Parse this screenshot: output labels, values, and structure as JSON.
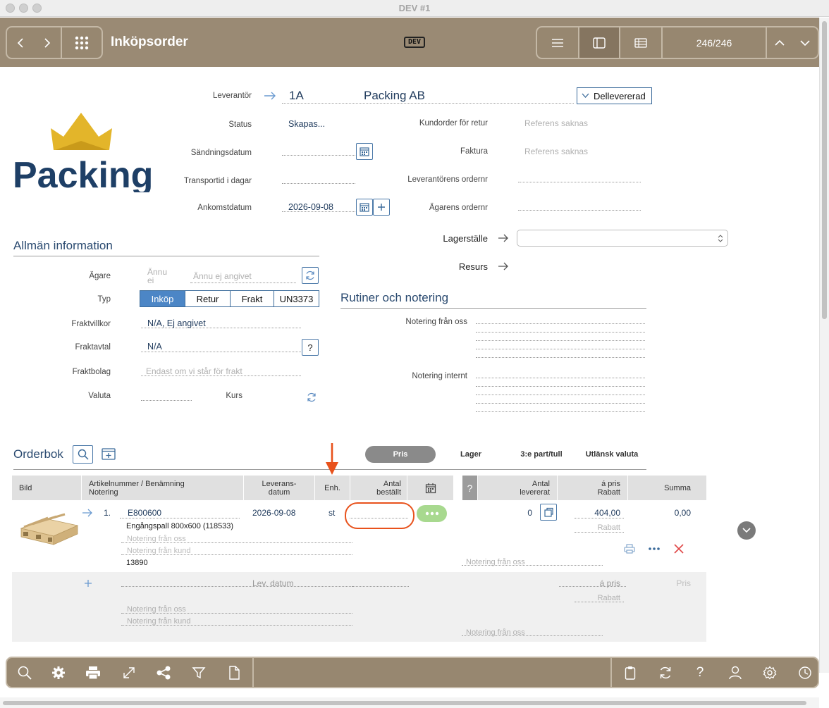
{
  "window": {
    "title": "DEV #1"
  },
  "header": {
    "title": "Inköpsorder",
    "badge": "DEV",
    "counter": "246/246"
  },
  "supplier": {
    "label": "Leverantör",
    "code": "1A",
    "name": "Packing AB",
    "delivery_status": "Dellevererad"
  },
  "logo_text": "Packing",
  "fields": {
    "status_label": "Status",
    "status_value": "Skapas...",
    "shipping_date_label": "Sändningsdatum",
    "transport_label": "Transportid i dagar",
    "arrival_label": "Ankomstdatum",
    "arrival_value": "2026-09-08",
    "customer_order_label": "Kundorder för retur",
    "customer_order_ph": "Referens saknas",
    "invoice_label": "Faktura",
    "invoice_ph": "Referens saknas",
    "supplier_order_label": "Leverantörens ordernr",
    "owner_order_label": "Ägarens ordernr",
    "warehouse_label": "Lagerställe",
    "resource_label": "Resurs"
  },
  "general": {
    "title": "Allmän information",
    "owner_label": "Ägare",
    "owner_ph_short": "Ännu ej",
    "owner_ph": "Ännu ej angivet",
    "type_label": "Typ",
    "type_options": [
      "Inköp",
      "Retur",
      "Frakt",
      "UN3373"
    ],
    "freight_terms_label": "Fraktvillkor",
    "freight_terms_value": "N/A, Ej angivet",
    "freight_agreement_label": "Fraktavtal",
    "freight_agreement_value": "N/A",
    "carrier_label": "Fraktbolag",
    "carrier_ph": "Endast om vi står för frakt",
    "currency_label": "Valuta",
    "rate_label": "Kurs"
  },
  "routines": {
    "title": "Rutiner och notering",
    "note_ours_label": "Notering från oss",
    "note_internal_label": "Notering internt"
  },
  "orderbook": {
    "title": "Orderbok",
    "tabs": [
      "Pris",
      "Lager",
      "3:e part/tull",
      "Utlänsk valuta"
    ],
    "columns": {
      "image": "Bild",
      "article": "Artikelnummer / Benämning",
      "note": "Notering",
      "delivery_l1": "Leverans-",
      "delivery_l2": "datum",
      "unit": "Enh.",
      "ordered_l1": "Antal",
      "ordered_l2": "beställt",
      "help": "?",
      "delivered_l1": "Antal",
      "delivered_l2": "levererat",
      "price_l1": "á pris",
      "price_l2": "Rabatt",
      "sum": "Summa"
    },
    "row": {
      "index": "1.",
      "article": "E800600",
      "description": "Engångspall 800x600 (118533)",
      "note_ours_ph": "Notering från oss",
      "note_customer_ph": "Notering från kund",
      "code": "13890",
      "date": "2026-09-08",
      "unit": "st",
      "delivered": "0",
      "price": "404,00",
      "discount_ph": "Rabatt",
      "sum": "0,00"
    },
    "new_row": {
      "date_ph": "Lev. datum",
      "price_ph": "á pris",
      "discount_ph": "Rabatt",
      "pris_ph": "Pris",
      "note_ours_ph": "Notering från oss",
      "note_customer_ph": "Notering från kund"
    }
  },
  "colors": {
    "header": "#9a8a74",
    "accent": "#4c86c6",
    "annotation": "#e8521c",
    "green": "#a8d98f"
  }
}
